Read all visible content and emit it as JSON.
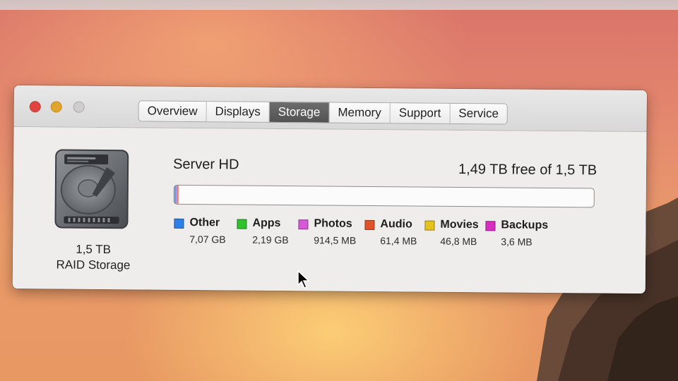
{
  "window": {
    "tabs": [
      {
        "label": "Overview"
      },
      {
        "label": "Displays"
      },
      {
        "label": "Storage"
      },
      {
        "label": "Memory"
      },
      {
        "label": "Support"
      },
      {
        "label": "Service"
      }
    ],
    "active_tab": "Storage"
  },
  "device": {
    "capacity_label": "1,5 TB",
    "type_label": "RAID Storage",
    "icon": "hard-drive-icon"
  },
  "volume": {
    "name": "Server HD",
    "free_text": "1,49 TB free of 1,5 TB",
    "used_fraction": 0.0068
  },
  "legend": [
    {
      "label": "Other",
      "size": "7,07 GB",
      "color": "#2f7fe8"
    },
    {
      "label": "Apps",
      "size": "2,19 GB",
      "color": "#2fc22b"
    },
    {
      "label": "Photos",
      "size": "914,5 MB",
      "color": "#d65ad8"
    },
    {
      "label": "Audio",
      "size": "61,4 MB",
      "color": "#e0522a"
    },
    {
      "label": "Movies",
      "size": "46,8 MB",
      "color": "#e6c21f"
    },
    {
      "label": "Backups",
      "size": "3,6 MB",
      "color": "#d92fc0"
    }
  ],
  "colors": {
    "active_tab": "#5c5b5b",
    "window_bg": "#eeedec",
    "close": "#e0443e",
    "minimize": "#e1a52e"
  }
}
